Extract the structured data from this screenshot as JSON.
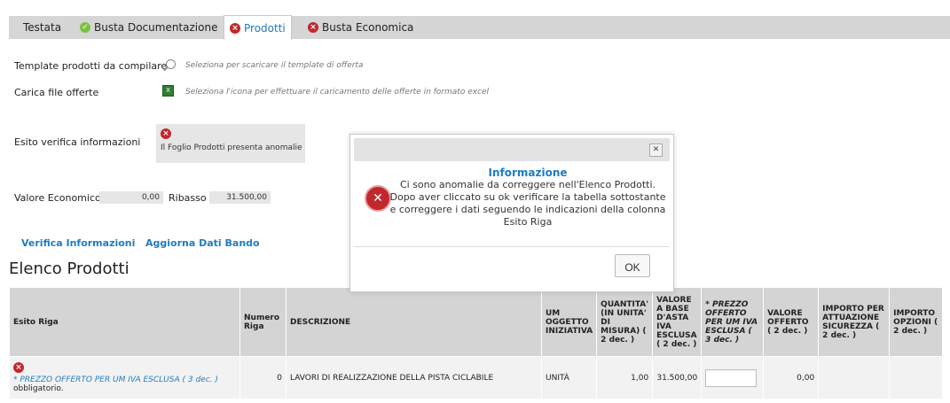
{
  "tabs": [
    {
      "label": "Testata",
      "icon": "none"
    },
    {
      "label": "Busta Documentazione",
      "icon": "check-icon"
    },
    {
      "label": "Prodotti",
      "icon": "error-icon",
      "active": true
    },
    {
      "label": "Busta Economica",
      "icon": "error-icon"
    }
  ],
  "form": {
    "template_label": "Template prodotti da compilare",
    "template_hint": "Seleziona per scaricare il template di offerta",
    "upload_label": "Carica file offerte",
    "upload_hint": "Seleziona l'icona per effettuare il caricamento delle offerte in formato excel",
    "esito_label": "Esito verifica informazioni",
    "esito_text": "Il Foglio Prodotti presenta anomalie",
    "valore_label": "Valore Economico",
    "valore_value": "0,00",
    "ribasso_label": "Ribasso",
    "ribasso_value": "31.500,00"
  },
  "links": {
    "verifica": "Verifica Informazioni",
    "aggiorna": "Aggiorna Dati Bando"
  },
  "section_title": "Elenco Prodotti",
  "table": {
    "headers": [
      "Esito Riga",
      "Numero Riga",
      "DESCRIZIONE",
      "UM OGGETTO INIZIATIVA",
      "QUANTITA' (IN UNITA' DI MISURA) ( 2 dec. )",
      "VALORE A BASE D'ASTA IVA ESCLUSA ( 2 dec. )",
      "* PREZZO OFFERTO PER UM IVA ESCLUSA ( 3 dec. )",
      "VALORE OFFERTO ( 2 dec. )",
      "IMPORTO PER ATTUAZIONE SICUREZZA ( 2 dec. )",
      "IMPORTO OPZIONI ( 2 dec. )"
    ],
    "row": {
      "esito_msg": "* PREZZO OFFERTO PER UM IVA ESCLUSA ( 3 dec. )",
      "esito_suffix": "obbligatorio.",
      "numero": "0",
      "descrizione": "LAVORI DI REALIZZAZIONE DELLA PISTA CICLABILE",
      "um": "UNITÀ",
      "quantita": "1,00",
      "valore_base": "31.500,00",
      "prezzo": "",
      "valore_offerto": "0,00",
      "importo_sicurezza": "",
      "importo_opzioni": ""
    }
  },
  "modal": {
    "title": "Informazione",
    "message": "Ci sono anomalie da correggere nell'Elenco Prodotti. Dopo aver cliccato su ok verificare la tabella sottostante e correggere i dati seguendo le indicazioni della colonna Esito Riga",
    "ok_label": "OK"
  },
  "colors": {
    "link": "#1f7cc1",
    "error": "#c0282d",
    "ok": "#7bc043",
    "header_bg": "#d4d4d4"
  }
}
